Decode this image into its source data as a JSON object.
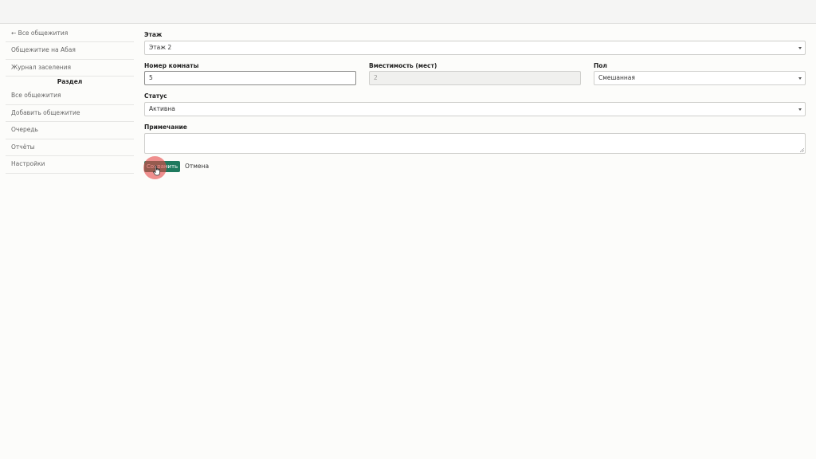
{
  "sidebar": {
    "back_link": "← Все общежития",
    "items_top": [
      "Общежитие на Абая",
      "Журнал заселения"
    ],
    "section_heading": "Раздел",
    "items_bottom": [
      "Все общежития",
      "Добавить общежитие",
      "Очередь",
      "Отчёты",
      "Настройки"
    ]
  },
  "form": {
    "floor": {
      "label": "Этаж",
      "value": "Этаж 2"
    },
    "room_number": {
      "label": "Номер комнаты",
      "value": "5"
    },
    "capacity": {
      "label": "Вместимость (мест)",
      "value": "2"
    },
    "gender": {
      "label": "Пол",
      "value": "Смешанная"
    },
    "status": {
      "label": "Статус",
      "value": "Активна"
    },
    "note": {
      "label": "Примечание",
      "value": ""
    }
  },
  "actions": {
    "save_label": "Сохранить",
    "cancel_label": "Отмена"
  },
  "colors": {
    "save_button": "#1f7a5e",
    "click_indicator": "#e64646"
  }
}
